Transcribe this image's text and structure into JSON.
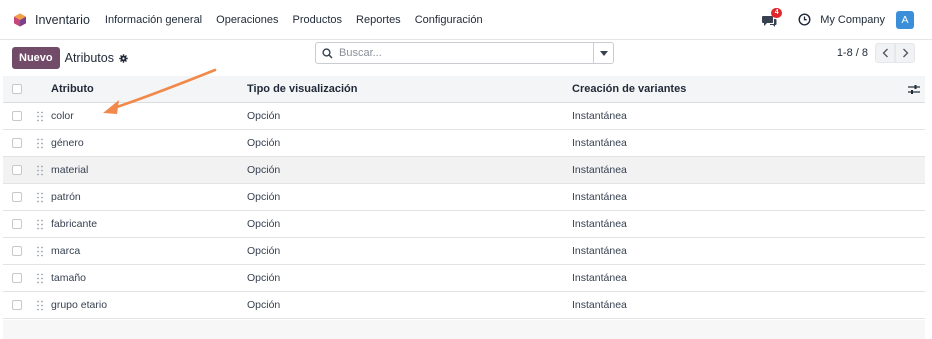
{
  "navbar": {
    "app_name": "Inventario",
    "menu": [
      "Información general",
      "Operaciones",
      "Productos",
      "Reportes",
      "Configuración"
    ],
    "chat_badge": "4",
    "company": "My Company",
    "avatar_letter": "A",
    "icons": {
      "logo": "hexagon-logo-icon",
      "chat": "chat-icon",
      "clock": "clock-icon"
    }
  },
  "control": {
    "new_button": "Nuevo",
    "title": "Atributos",
    "search_placeholder": "Buscar...",
    "pager": "1-8 / 8"
  },
  "table": {
    "headers": [
      "Atributo",
      "Tipo de visualización",
      "Creación de variantes"
    ],
    "rows": [
      {
        "name": "color",
        "type": "Opción",
        "creation": "Instantánea"
      },
      {
        "name": "género",
        "type": "Opción",
        "creation": "Instantánea"
      },
      {
        "name": "material",
        "type": "Opción",
        "creation": "Instantánea"
      },
      {
        "name": "patrón",
        "type": "Opción",
        "creation": "Instantánea"
      },
      {
        "name": "fabricante",
        "type": "Opción",
        "creation": "Instantánea"
      },
      {
        "name": "marca",
        "type": "Opción",
        "creation": "Instantánea"
      },
      {
        "name": "tamaño",
        "type": "Opción",
        "creation": "Instantánea"
      },
      {
        "name": "grupo etario",
        "type": "Opción",
        "creation": "Instantánea"
      }
    ]
  },
  "colors": {
    "primary": "#714b67",
    "badge": "#e0262b",
    "avatar": "#3b8fd9",
    "annotation_arrow": "#f0894a"
  }
}
